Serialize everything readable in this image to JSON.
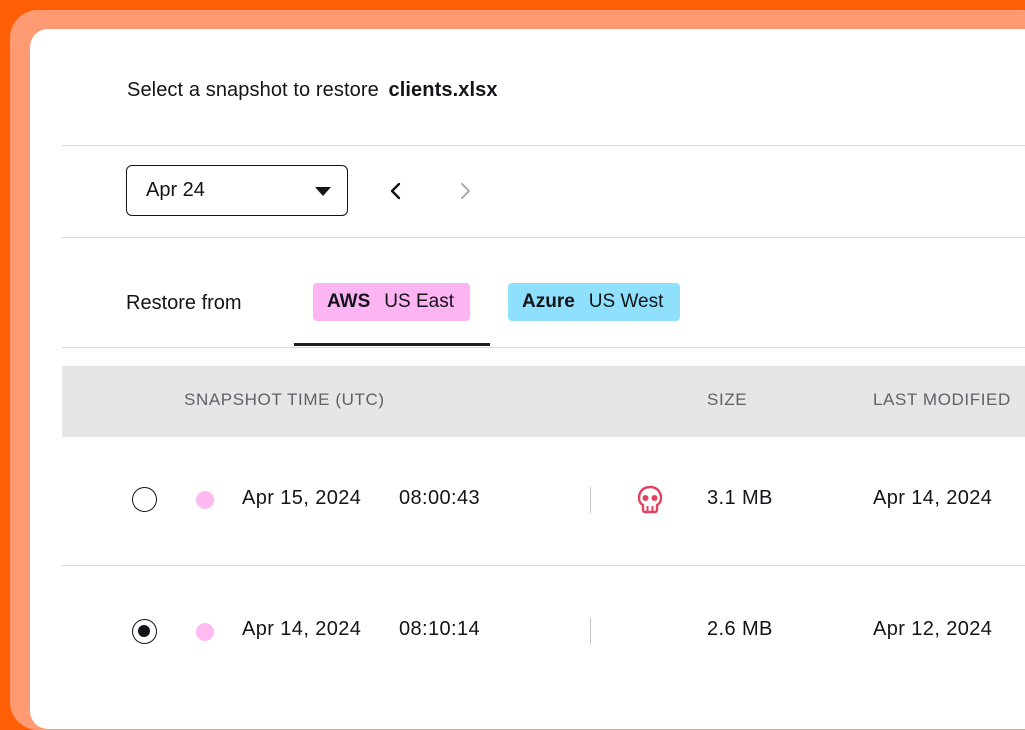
{
  "header": {
    "title_prefix": "Select a snapshot to restore",
    "file_name": "clients.xlsx"
  },
  "date_picker": {
    "selected": "Apr 24"
  },
  "restore": {
    "label": "Restore from",
    "tabs": [
      {
        "provider": "AWS",
        "region": "US East",
        "color": "#fdb4f3",
        "active": true
      },
      {
        "provider": "Azure",
        "region": "US West",
        "color": "#8ee0fc",
        "active": false
      }
    ]
  },
  "table": {
    "columns": {
      "snapshot_time": "SNAPSHOT TIME (UTC)",
      "size": "SIZE",
      "last_modified": "LAST MODIFIED"
    },
    "rows": [
      {
        "date": "Apr 15, 2024",
        "time": "08:00:43",
        "size": "3.1 MB",
        "last_modified": "Apr 14, 2024",
        "selected": false,
        "flag_icon": "skull-icon"
      },
      {
        "date": "Apr 14, 2024",
        "time": "08:10:14",
        "size": "2.6 MB",
        "last_modified": "Apr 12, 2024",
        "selected": true,
        "flag_icon": ""
      }
    ]
  },
  "colors": {
    "brand_orange": "#ff5f05",
    "aws_pink": "#fdb4f3",
    "azure_blue": "#8ee0fc",
    "danger_red": "#e0425f"
  }
}
